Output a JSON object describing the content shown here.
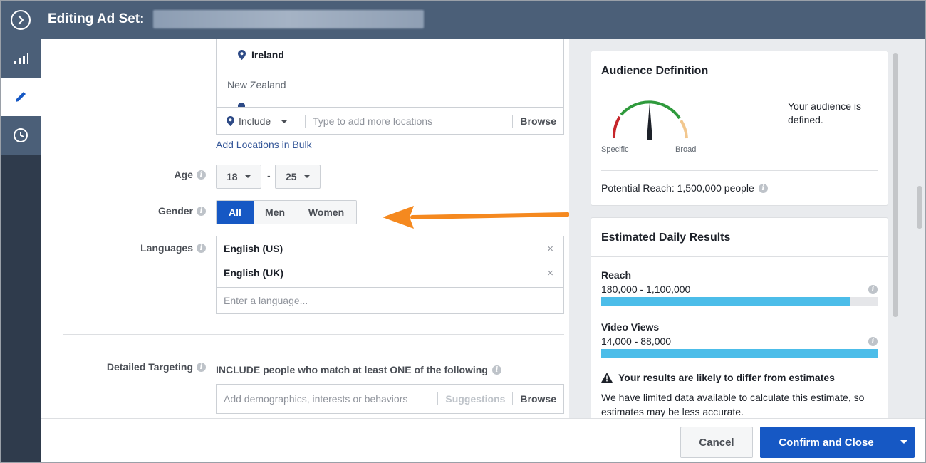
{
  "header": {
    "title": "Editing Ad Set:",
    "expand_icon": "chevron-right-circle-icon"
  },
  "rail": {
    "items": [
      {
        "name": "stats",
        "icon": "bar-chart-icon"
      },
      {
        "name": "edit",
        "icon": "pencil-icon",
        "active": true
      },
      {
        "name": "history",
        "icon": "clock-icon"
      }
    ]
  },
  "locations": {
    "items": [
      "Ireland",
      "New Zealand"
    ],
    "include_label": "Include",
    "input_placeholder": "Type to add more locations",
    "browse_label": "Browse",
    "bulk_link": "Add Locations in Bulk"
  },
  "age": {
    "label": "Age",
    "min": "18",
    "max": "25",
    "separator": "-"
  },
  "gender": {
    "label": "Gender",
    "options": [
      "All",
      "Men",
      "Women"
    ],
    "selected": "All"
  },
  "languages": {
    "label": "Languages",
    "items": [
      "English (US)",
      "English (UK)"
    ],
    "remove_symbol": "×",
    "input_placeholder": "Enter a language..."
  },
  "detailed_targeting": {
    "label": "Detailed Targeting",
    "include_text": "INCLUDE people who match at least ONE of the following",
    "input_placeholder": "Add demographics, interests or behaviors",
    "suggestions_label": "Suggestions",
    "browse_label": "Browse"
  },
  "audience_definition": {
    "title": "Audience Definition",
    "gauge_left": "Specific",
    "gauge_right": "Broad",
    "status": "Your audience is defined.",
    "potential_reach": "Potential Reach: 1,500,000 people"
  },
  "estimated_results": {
    "title": "Estimated Daily Results",
    "metrics": [
      {
        "label": "Reach",
        "range": "180,000 - 1,100,000",
        "fill": 0.9
      },
      {
        "label": "Video Views",
        "range": "14,000 - 88,000",
        "fill": 1.0
      }
    ],
    "warning_title": "Your results are likely to differ from estimates",
    "warning_body": "We have limited data available to calculate this estimate, so estimates may be less accurate."
  },
  "footer": {
    "cancel_label": "Cancel",
    "confirm_label": "Confirm and Close"
  },
  "colors": {
    "accent": "#1658c4",
    "header_bg": "#4b5f78",
    "bar": "#4cbde9",
    "annotation_arrow": "#f5891f"
  }
}
